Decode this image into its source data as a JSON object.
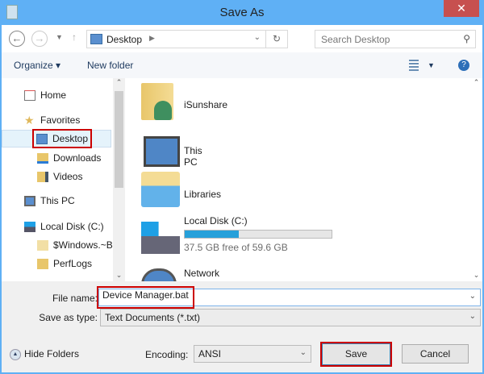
{
  "window": {
    "title": "Save As",
    "close": "✕"
  },
  "nav": {
    "path": "Desktop",
    "search_placeholder": "Search Desktop"
  },
  "toolbar": {
    "organize": "Organize ▾",
    "new_folder": "New folder"
  },
  "sidebar": {
    "items": [
      {
        "label": "Home"
      },
      {
        "label": "Favorites"
      },
      {
        "label": "Desktop"
      },
      {
        "label": "Downloads"
      },
      {
        "label": "Videos"
      },
      {
        "label": "This PC"
      },
      {
        "label": "Local Disk (C:)"
      },
      {
        "label": "$Windows.~BT"
      },
      {
        "label": "PerfLogs"
      }
    ]
  },
  "files": [
    {
      "name": "iSunshare"
    },
    {
      "name": "This PC"
    },
    {
      "name": "Libraries"
    },
    {
      "name": "Local Disk (C:)",
      "detail": "37.5 GB free of 59.6 GB",
      "used_fraction": 0.37
    },
    {
      "name": "Network"
    }
  ],
  "form": {
    "filename_label": "File name:",
    "filename": "Device Manager.bat",
    "type_label": "Save as type:",
    "type": "Text Documents (*.txt)",
    "encoding_label": "Encoding:",
    "encoding": "ANSI"
  },
  "buttons": {
    "hide_folders": "Hide Folders",
    "save": "Save",
    "cancel": "Cancel"
  }
}
